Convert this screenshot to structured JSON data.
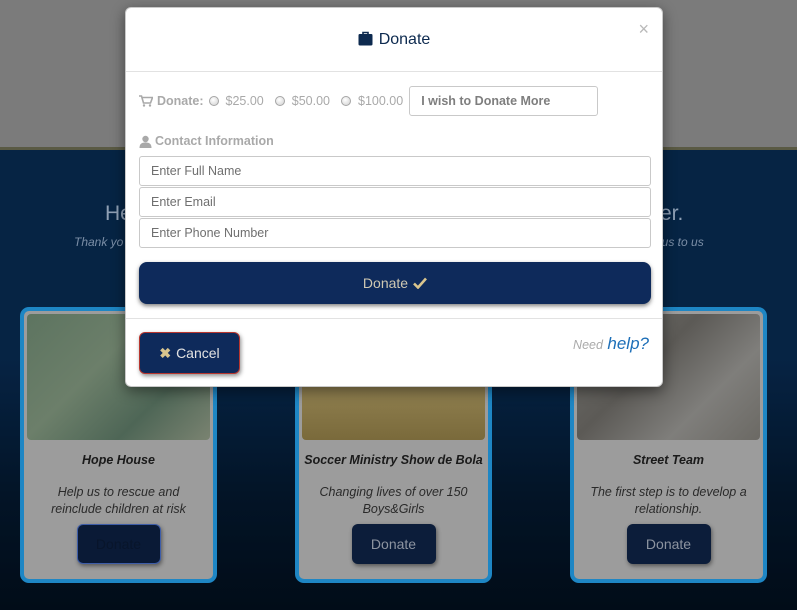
{
  "background": {
    "heading_left": "He",
    "heading_right": "er.",
    "subtext_left": "Thank yo",
    "subtext_right": "ous to us",
    "cards": [
      {
        "title": "Hope House",
        "text": "Help us to rescue and reinclude children at risk",
        "button": "Donate"
      },
      {
        "title": "Soccer Ministry Show de Bola",
        "text": "Changing lives of over 150 Boys&Girls",
        "button": "Donate"
      },
      {
        "title": "Street Team",
        "text": "The first step is to develop a relationship.",
        "button": "Donate"
      }
    ]
  },
  "modal": {
    "title": "Donate",
    "title_icon": "briefcase-icon",
    "close": "×",
    "donate_label": "Donate:",
    "amounts": [
      "$25.00",
      "$50.00",
      "$100.00"
    ],
    "donate_more_placeholder": "I wish to Donate More",
    "contact_label": "Contact Information",
    "fields": {
      "full_name": "Enter Full Name",
      "email": "Enter Email",
      "phone": "Enter Phone Number"
    },
    "donate_button": "Donate",
    "cancel_button": "Cancel",
    "help_need": "Need",
    "help_link": "help?"
  },
  "colors": {
    "navy": "#0e2a5b",
    "card_border": "#1e86c4",
    "help_link": "#1d6fb8",
    "checkmark": "#d9c58e"
  }
}
